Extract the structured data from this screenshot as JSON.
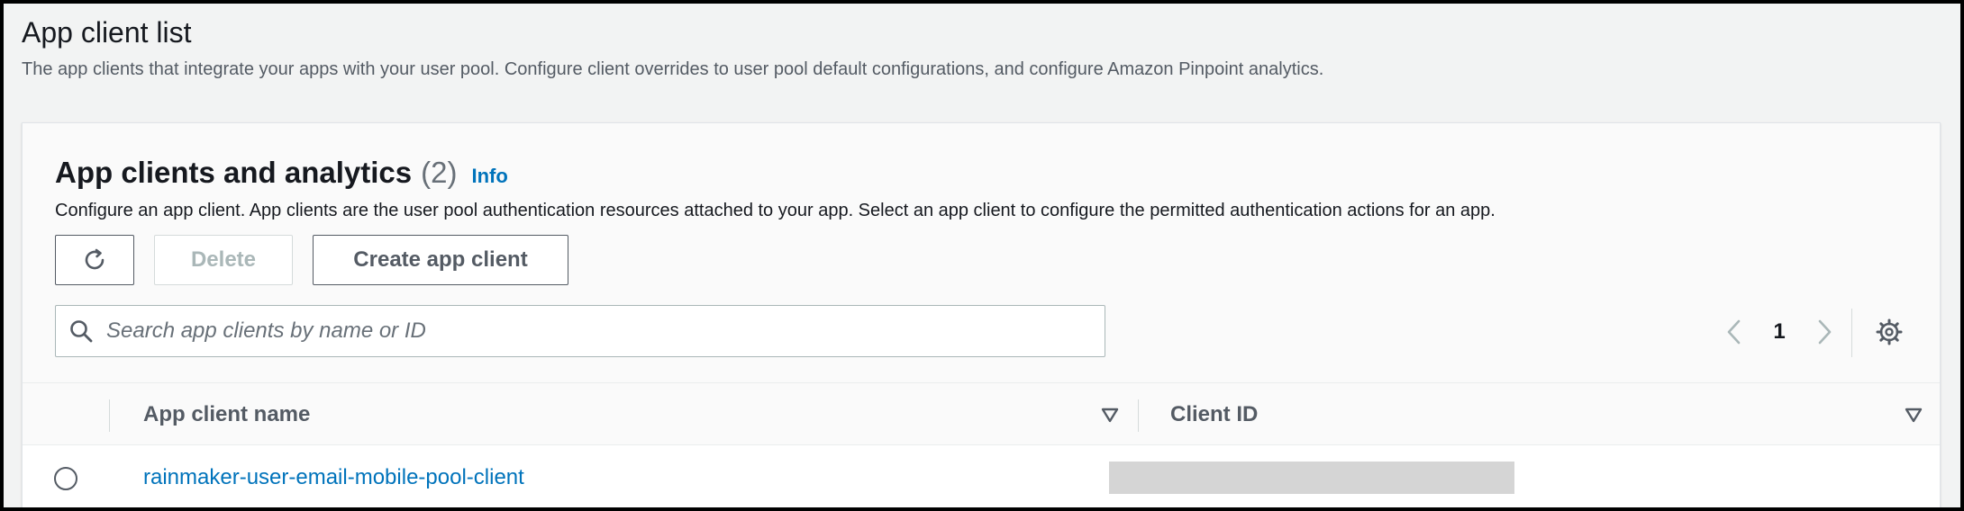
{
  "page": {
    "title": "App client list",
    "description": "The app clients that integrate your apps with your user pool. Configure client overrides to user pool default configurations, and configure Amazon Pinpoint analytics."
  },
  "panel": {
    "title": "App clients and analytics",
    "count": "(2)",
    "info_label": "Info",
    "description": "Configure an app client. App clients are the user pool authentication resources attached to your app. Select an app client to configure the permitted authentication actions for an app."
  },
  "toolbar": {
    "refresh_icon": "refresh-icon",
    "delete_label": "Delete",
    "create_label": "Create app client"
  },
  "search": {
    "placeholder": "Search app clients by name or ID",
    "value": ""
  },
  "pagination": {
    "current_page": "1"
  },
  "table": {
    "columns": [
      "App client name",
      "Client ID"
    ],
    "rows": [
      {
        "name": "rainmaker-user-email-mobile-pool-client",
        "client_id_redacted": true
      }
    ]
  },
  "colors": {
    "link": "#0073bb",
    "text": "#16191f",
    "muted": "#545b64",
    "background": "#f2f3f3"
  }
}
